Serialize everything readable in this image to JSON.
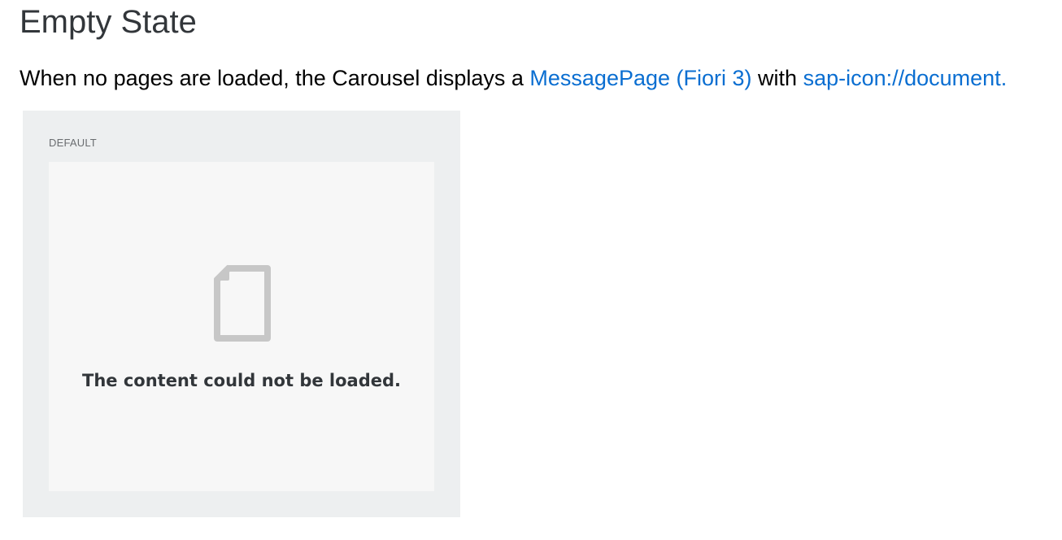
{
  "page": {
    "title": "Empty State"
  },
  "intro": {
    "text_before": "When no pages are loaded, the Carousel displays a ",
    "link_message_page": "MessagePage (Fiori 3)",
    "text_middle": " with ",
    "link_icon": "sap-icon://document."
  },
  "example": {
    "label": "DEFAULT",
    "message_page": {
      "icon": "document-icon",
      "text": "The content could not be loaded."
    }
  },
  "colors": {
    "link": "#0a6ed1",
    "frame_background": "#edeff0",
    "message_page_background": "#f7f7f7",
    "icon": "#c7c7c7",
    "message_text": "#32363a"
  }
}
